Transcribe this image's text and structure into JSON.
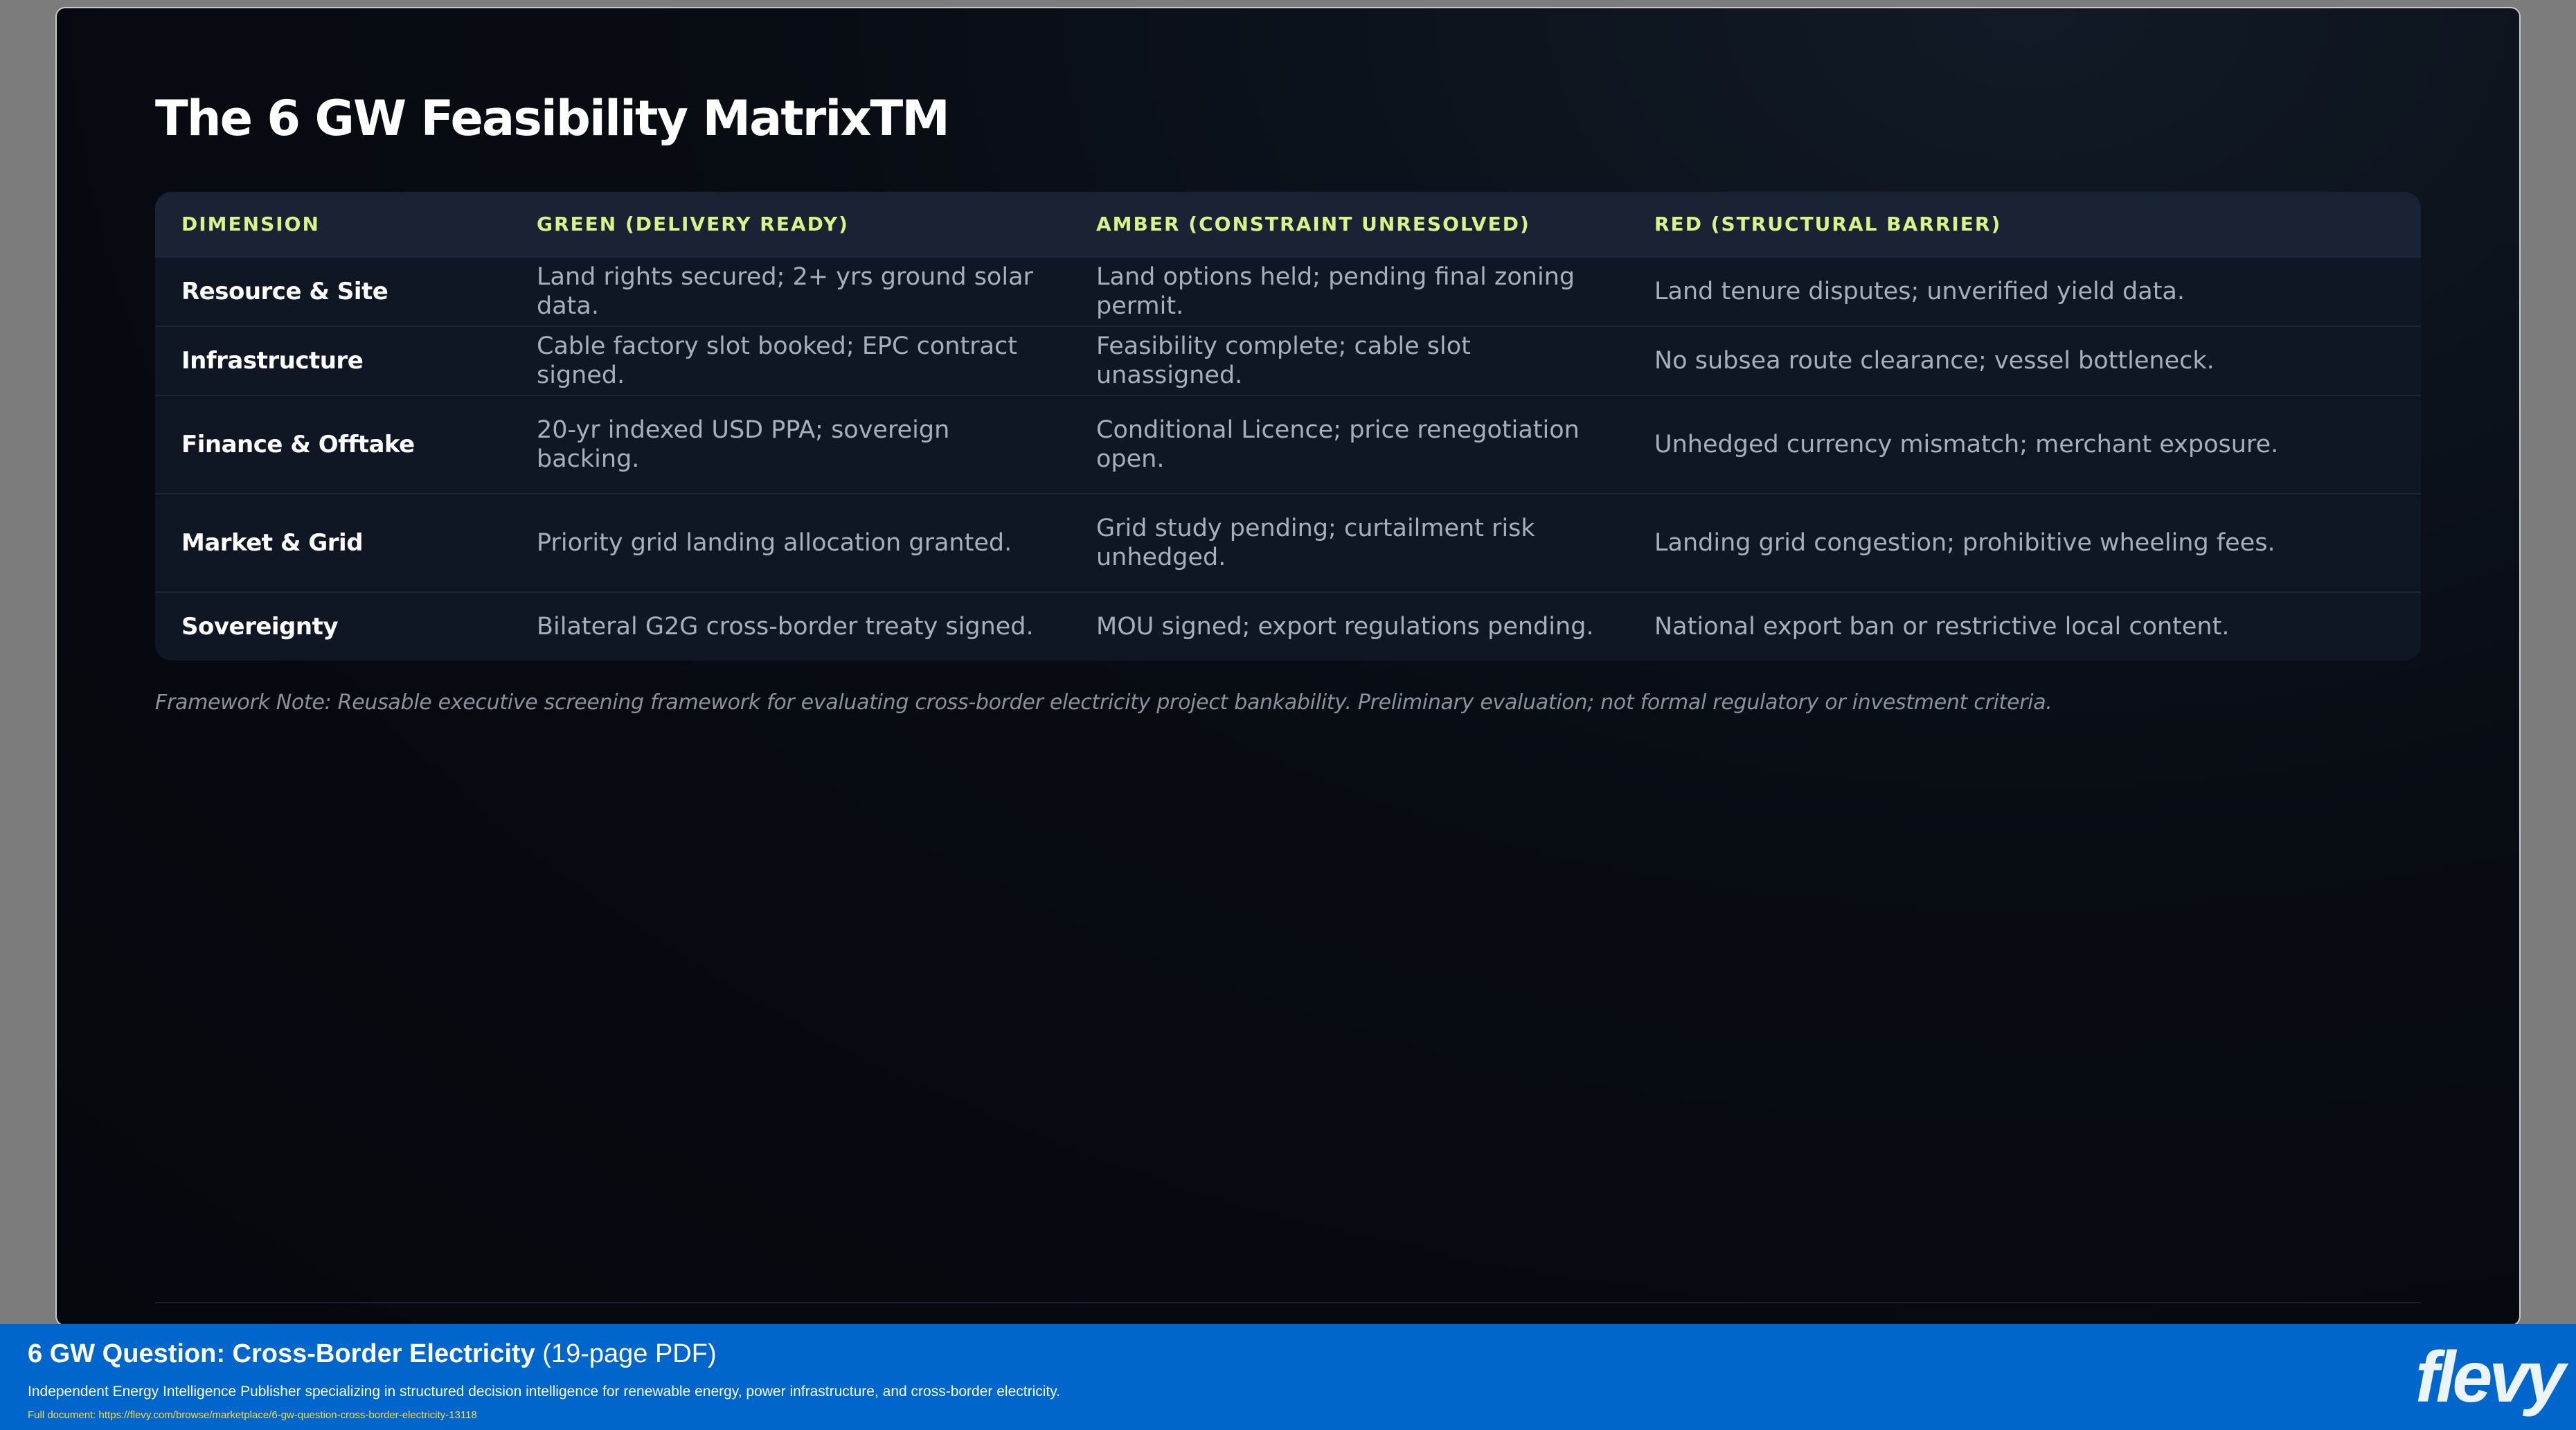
{
  "slide": {
    "title": "The 6 GW Feasibility MatrixTM",
    "note": "Framework Note: Reusable executive screening framework for evaluating cross-border electricity project bankability. Preliminary evaluation; not formal regulatory or investment criteria."
  },
  "matrix": {
    "headers": [
      "DIMENSION",
      "GREEN (DELIVERY READY)",
      "AMBER (CONSTRAINT UNRESOLVED)",
      "RED (STRUCTURAL BARRIER)"
    ],
    "rows": [
      {
        "dimension": "Resource & Site",
        "green": "Land rights secured; 2+ yrs ground solar data.",
        "amber": "Land options held; pending final zoning permit.",
        "red": "Land tenure disputes; unverified yield data."
      },
      {
        "dimension": "Infrastructure",
        "green": "Cable factory slot booked; EPC contract signed.",
        "amber": "Feasibility complete; cable slot unassigned.",
        "red": "No subsea route clearance; vessel bottleneck."
      },
      {
        "dimension": "Finance & Offtake",
        "green": "20-yr indexed USD PPA; sovereign backing.",
        "amber": "Conditional Licence; price renegotiation open.",
        "red": "Unhedged currency mismatch; merchant exposure."
      },
      {
        "dimension": "Market & Grid",
        "green": "Priority grid landing allocation granted.",
        "amber": "Grid study pending; curtailment risk unhedged.",
        "red": "Landing grid congestion; prohibitive wheeling fees."
      },
      {
        "dimension": "Sovereignty",
        "green": "Bilateral G2G cross-border treaty signed.",
        "amber": "MOU signed; export regulations pending.",
        "red": "National export ban or restrictive local content."
      }
    ]
  },
  "footer": {
    "doc_title": "6 GW Question: Cross-Border Electricity",
    "doc_pages": "(19-page PDF)",
    "description": "Independent Energy Intelligence Publisher specializing in structured decision intelligence for renewable energy, power infrastructure, and cross-border electricity.",
    "link": "Full document: https://flevy.com/browse/marketplace/6-gw-question-cross-border-electricity-13118",
    "brand": "flevy"
  },
  "colors": {
    "slide_background": "#080c13",
    "header_accent": "#d7f48a",
    "footer_bar": "#0066cc",
    "link": "#ffd84a"
  }
}
